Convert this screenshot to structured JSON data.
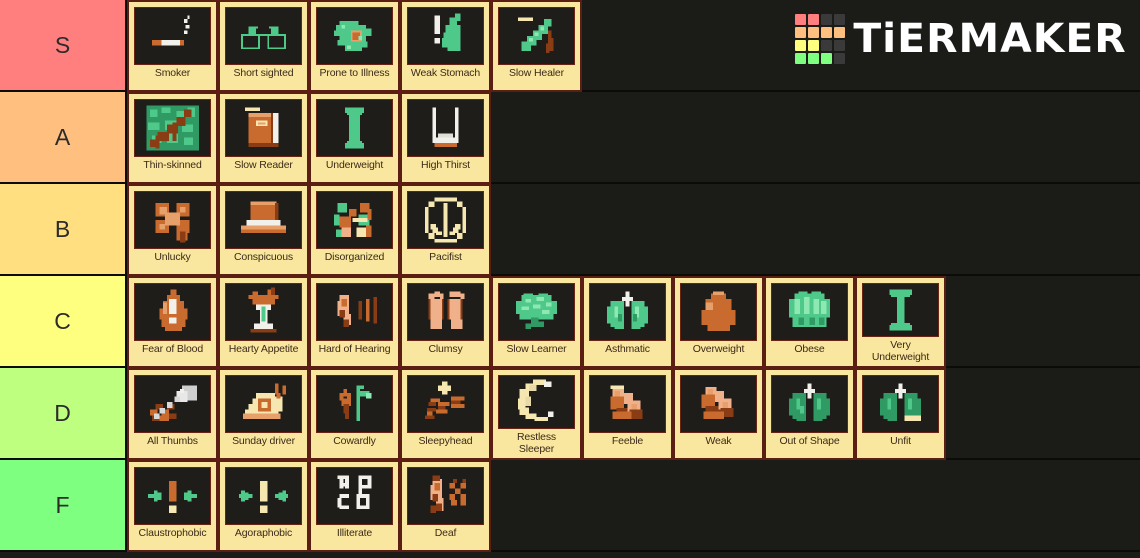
{
  "app": {
    "brand": "TiERMAKER",
    "logo_name": "tiermaker-logo",
    "logo_grid_colors": [
      [
        "#ff7f7f",
        "#ff7f7f",
        "#3a3a3a",
        "#3a3a3a"
      ],
      [
        "#ffbf7f",
        "#ffbf7f",
        "#ffbf7f",
        "#ffbf7f"
      ],
      [
        "#ffff7f",
        "#ffff7f",
        "#3a3a3a",
        "#3a3a3a"
      ],
      [
        "#7fff7f",
        "#7fff7f",
        "#7fff7f",
        "#3a3a3a"
      ]
    ],
    "background_color": "#1b1b17",
    "tile_color": "#fae79f",
    "tile_border_color": "#5a1e12",
    "tile_image_bg": "#1f1d19",
    "label_text_color": "#3b2a18"
  },
  "tiers": [
    {
      "label": "S",
      "color": "#ff7f7f",
      "height": 92,
      "items": [
        {
          "name": "Smoker",
          "icon": "cigarette-icon"
        },
        {
          "name": "Short sighted",
          "icon": "glasses-icon"
        },
        {
          "name": "Prone to Illness",
          "icon": "germ-blob-icon"
        },
        {
          "name": "Weak Stomach",
          "icon": "stomach-alert-icon"
        },
        {
          "name": "Slow Healer",
          "icon": "bandage-icon"
        }
      ]
    },
    {
      "label": "A",
      "color": "#ffbf7f",
      "height": 92,
      "items": [
        {
          "name": "Thin-skinned",
          "icon": "scratched-skin-icon"
        },
        {
          "name": "Slow Reader",
          "icon": "book-icon"
        },
        {
          "name": "Underweight",
          "icon": "thin-body-icon"
        },
        {
          "name": "High Thirst",
          "icon": "empty-glass-icon"
        }
      ]
    },
    {
      "label": "B",
      "color": "#ffdf7f",
      "height": 92,
      "items": [
        {
          "name": "Unlucky",
          "icon": "clover-icon"
        },
        {
          "name": "Conspicuous",
          "icon": "top-hat-icon"
        },
        {
          "name": "Disorganized",
          "icon": "scattered-items-icon"
        },
        {
          "name": "Pacifist",
          "icon": "peace-sign-icon"
        }
      ]
    },
    {
      "label": "C",
      "color": "#ffff7f",
      "height": 92,
      "items": [
        {
          "name": "Fear of Blood",
          "icon": "blood-drop-alert-icon"
        },
        {
          "name": "Hearty Appetite",
          "icon": "cocktail-glass-icon"
        },
        {
          "name": "Hard of Hearing",
          "icon": "ear-soundwave-icon"
        },
        {
          "name": "Clumsy",
          "icon": "feet-icon"
        },
        {
          "name": "Slow Learner",
          "icon": "brain-icon"
        },
        {
          "name": "Asthmatic",
          "icon": "lungs-icon"
        },
        {
          "name": "Overweight",
          "icon": "heavy-body-icon"
        },
        {
          "name": "Obese",
          "icon": "fat-body-icon"
        },
        {
          "name": "Very\nUnderweight",
          "icon": "very-thin-body-icon"
        }
      ]
    },
    {
      "label": "D",
      "color": "#bfff7f",
      "height": 92,
      "items": [
        {
          "name": "All Thumbs",
          "icon": "needle-thread-icon"
        },
        {
          "name": "Sunday driver",
          "icon": "snail-icon"
        },
        {
          "name": "Cowardly",
          "icon": "wilting-plant-icon"
        },
        {
          "name": "Sleepyhead",
          "icon": "zzz-icon"
        },
        {
          "name": "Restless\nSleeper",
          "icon": "crescent-moon-icon"
        },
        {
          "name": "Feeble",
          "icon": "weak-arm-icon"
        },
        {
          "name": "Weak",
          "icon": "flexed-arm-icon"
        },
        {
          "name": "Out of Shape",
          "icon": "lungs-plain-icon"
        },
        {
          "name": "Unfit",
          "icon": "lungs-bar-icon"
        }
      ]
    },
    {
      "label": "F",
      "color": "#7fff7f",
      "height": 92,
      "items": [
        {
          "name": "Claustrophobic",
          "icon": "arrows-inward-icon"
        },
        {
          "name": "Agoraphobic",
          "icon": "arrows-outward-icon"
        },
        {
          "name": "Illiterate",
          "icon": "jumbled-letters-icon"
        },
        {
          "name": "Deaf",
          "icon": "ear-crossed-icon"
        }
      ]
    }
  ]
}
